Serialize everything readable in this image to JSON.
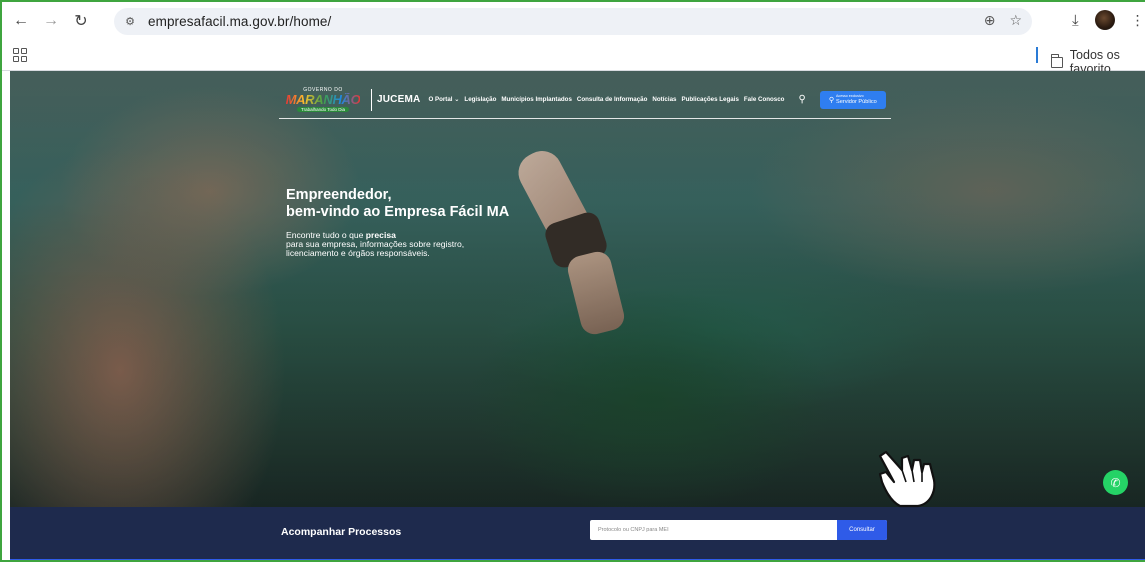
{
  "browser": {
    "back_icon": "arrow-left-icon",
    "forward_icon": "arrow-right-icon",
    "reload_icon": "reload-icon",
    "url": "empresafacil.ma.gov.br/home/",
    "bookmark_folder": "Todos os favorito"
  },
  "header": {
    "logo_top": "GOVERNO DO",
    "logo_main": "MARANHÃO",
    "logo_sub": "Trabalhando Todo Dia",
    "jucema": "JUCEMA",
    "nav": [
      "O Portal ⌄",
      "Legislação",
      "Municípios Implantados",
      "Consulta de Informação",
      "Notícias",
      "Publicações Legais",
      "Fale Conosco"
    ],
    "access_line1": "Acesso exclusivo",
    "access_line2": "Servidor Público"
  },
  "hero": {
    "title_line1": "Empreendedor,",
    "title_line2": "bem-vindo ao Empresa Fácil MA",
    "text_pre": "Encontre tudo o que ",
    "text_bold": "precisa",
    "text_line2": "para sua empresa, informações sobre registro,",
    "text_line3": "licenciamento e órgãos responsáveis."
  },
  "tracking": {
    "label": "Acompanhar Processos",
    "placeholder": "Protocolo ou CNPJ para MEI",
    "button": "Consultar"
  },
  "colors": {
    "primary_blue": "#2f5be8",
    "strip_navy": "#1e2a4d",
    "whatsapp_green": "#25d366"
  }
}
